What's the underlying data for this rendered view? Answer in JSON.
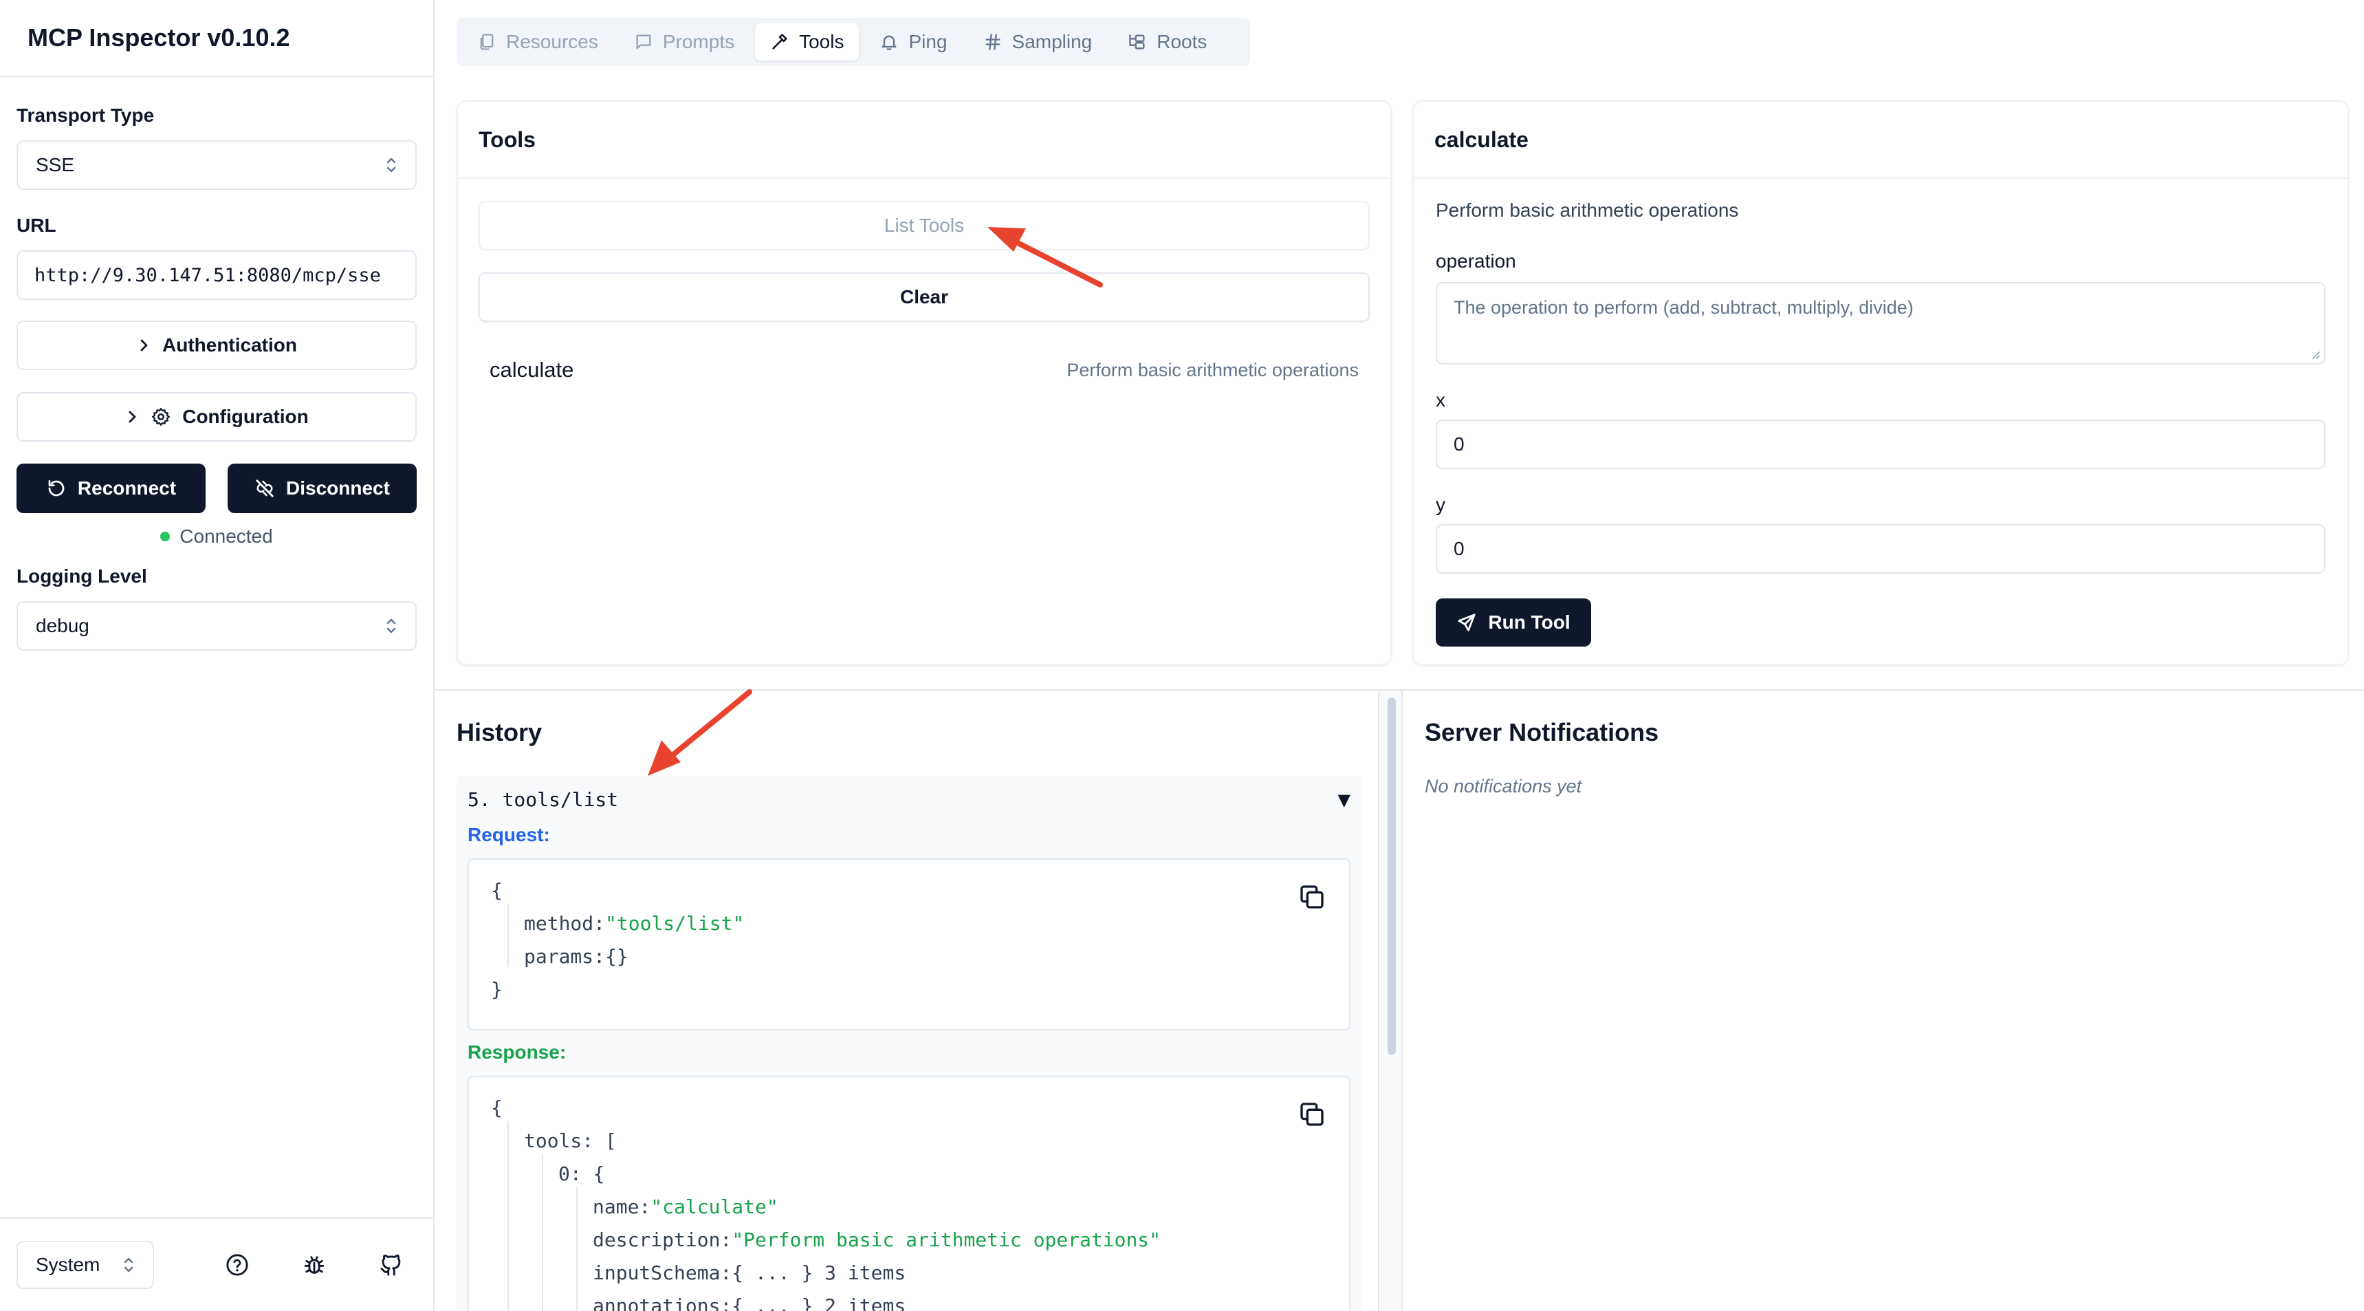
{
  "app": {
    "title": "MCP Inspector v0.10.2"
  },
  "sidebar": {
    "transport_label": "Transport Type",
    "transport_value": "SSE",
    "url_label": "URL",
    "url_value": "http://9.30.147.51:8080/mcp/sse",
    "authentication_label": "Authentication",
    "configuration_label": "Configuration",
    "reconnect_label": "Reconnect",
    "disconnect_label": "Disconnect",
    "status_text": "Connected",
    "status_color": "#22c55e",
    "logging_label": "Logging Level",
    "logging_value": "debug",
    "theme_value": "System",
    "footer_icons": [
      "help-circle-icon",
      "bug-icon",
      "github-icon"
    ]
  },
  "tabs": [
    {
      "label": "Resources",
      "icon": "files-icon",
      "state": "dim"
    },
    {
      "label": "Prompts",
      "icon": "message-square-icon",
      "state": "dim"
    },
    {
      "label": "Tools",
      "icon": "hammer-icon",
      "state": "active"
    },
    {
      "label": "Ping",
      "icon": "bell-icon",
      "state": "normal"
    },
    {
      "label": "Sampling",
      "icon": "hash-icon",
      "state": "normal"
    },
    {
      "label": "Roots",
      "icon": "folder-tree-icon",
      "state": "normal"
    }
  ],
  "tools_panel": {
    "title": "Tools",
    "list_button": "List Tools",
    "clear_button": "Clear",
    "items": [
      {
        "name": "calculate",
        "description": "Perform basic arithmetic operations"
      }
    ]
  },
  "tool_detail": {
    "title": "calculate",
    "description": "Perform basic arithmetic operations",
    "operation_label": "operation",
    "operation_placeholder": "The operation to perform (add, subtract, multiply, divide)",
    "x_label": "x",
    "x_value": "0",
    "y_label": "y",
    "y_value": "0",
    "run_button": "Run Tool"
  },
  "history": {
    "title": "History",
    "entry": {
      "header": "5. tools/list",
      "caret": "▼",
      "request_label": "Request:",
      "response_label": "Response:",
      "request_lines": {
        "open": "{",
        "method_key": "method:",
        "method_value": "\"tools/list\"",
        "params_key": "params:",
        "params_value": "{}",
        "close": "}"
      },
      "response_lines": {
        "open": "{",
        "tools_key": "tools: [",
        "item_key": "0: {",
        "name_key": "name:",
        "name_value": "\"calculate\"",
        "description_key": "description:",
        "description_value": "\"Perform basic arithmetic operations\"",
        "input_schema_key": "inputSchema:",
        "input_schema_value": "{ ... }",
        "input_schema_count": "3 items",
        "annotations_key": "annotations:",
        "annotations_value": "{ ... }",
        "annotations_count": "2 items"
      }
    }
  },
  "notifications": {
    "title": "Server Notifications",
    "empty_text": "No notifications yet"
  },
  "annotation_color": "#e8432e"
}
